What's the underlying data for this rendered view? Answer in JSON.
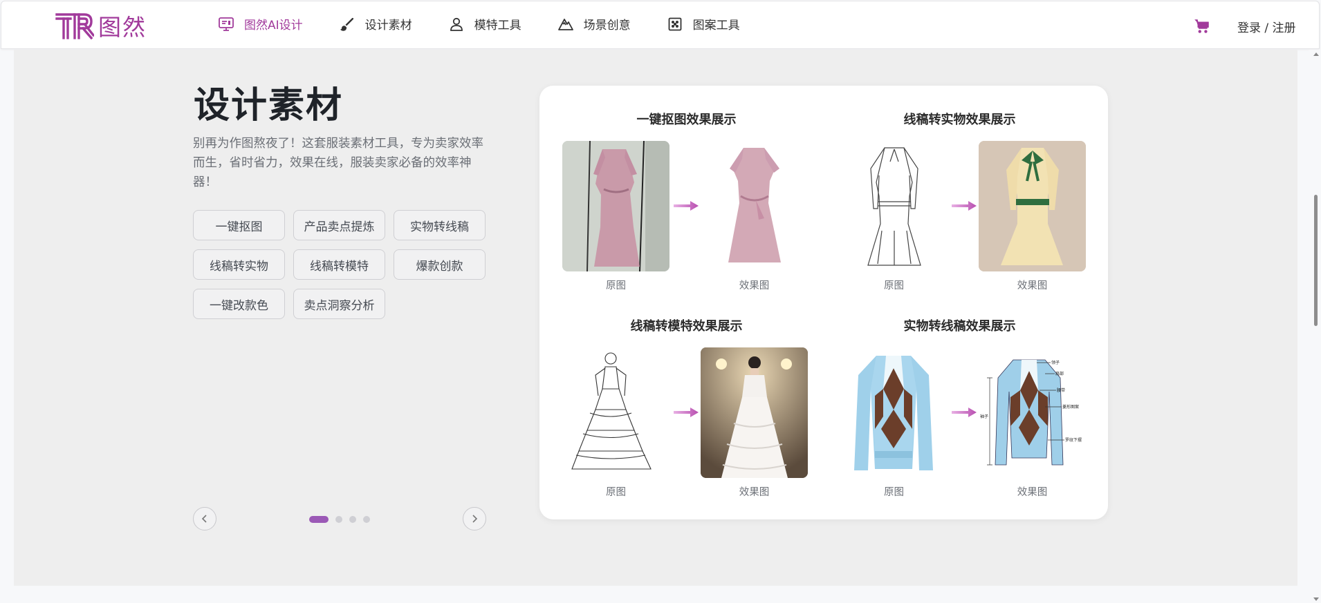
{
  "header": {
    "logo_mark": "TR",
    "logo_text": "图然",
    "nav": [
      {
        "label": "图然AI设计",
        "icon": "monitor-icon",
        "active": true
      },
      {
        "label": "设计素材",
        "icon": "brush-icon",
        "active": false
      },
      {
        "label": "模特工具",
        "icon": "user-icon",
        "active": false
      },
      {
        "label": "场景创意",
        "icon": "mountain-icon",
        "active": false
      },
      {
        "label": "图案工具",
        "icon": "pattern-grid-icon",
        "active": false
      }
    ],
    "cart_icon": "cart-icon",
    "login_label": "登录 / 注册"
  },
  "hero": {
    "title": "设计素材",
    "description": "别再为作图熬夜了！这套服装素材工具，专为卖家效率而生，省时省力，效果在线，服装卖家必备的效率神器！",
    "chips": [
      "一键抠图",
      "产品卖点提炼",
      "实物转线稿",
      "线稿转实物",
      "线稿转模特",
      "爆款创款",
      "一键改款色",
      "卖点洞察分析"
    ],
    "pager": {
      "prev_icon": "chevron-left-icon",
      "next_icon": "chevron-right-icon",
      "total": 4,
      "current": 1
    }
  },
  "showcase": {
    "sections": [
      {
        "title": "一键抠图效果展示",
        "before_label": "原图",
        "after_label": "效果图"
      },
      {
        "title": "线稿转实物效果展示",
        "before_label": "原图",
        "after_label": "效果图"
      },
      {
        "title": "线稿转模特效果展示",
        "before_label": "原图",
        "after_label": "效果图"
      },
      {
        "title": "实物转线稿效果展示",
        "before_label": "原图",
        "after_label": "效果图"
      }
    ],
    "annotations": {
      "a1": "领子",
      "a2": "肩部",
      "a3": "腰带",
      "a4": "菱形图案",
      "a5": "罗纹下摆",
      "a6": "袖子"
    }
  },
  "colors": {
    "brand": "#a13a9b",
    "accent_dot": "#9b59b6",
    "arrow": "#c060b8"
  }
}
